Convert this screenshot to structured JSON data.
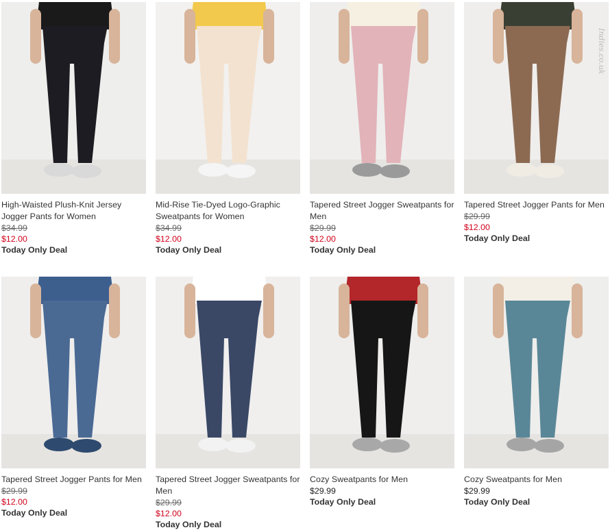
{
  "watermark": "Indies.co.uk",
  "products": [
    {
      "name": "High-Waisted Plush-Knit Jersey Jogger Pants for Women",
      "original_price": "$34.99",
      "sale_price": "$12.00",
      "price": "",
      "deal": "Today Only Deal",
      "pants_color": "#1c1c22",
      "top_color": "#1a1a1a",
      "shoe_color": "#d9d9d9",
      "bg": "#eeeeec"
    },
    {
      "name": "Mid-Rise Tie-Dyed Logo-Graphic Sweatpants for Women",
      "original_price": "$34.99",
      "sale_price": "$12.00",
      "price": "",
      "deal": "Today Only Deal",
      "pants_color": "#f3e2d0",
      "top_color": "#f2c94c",
      "shoe_color": "#f5f5f5",
      "bg": "#f2f1ef"
    },
    {
      "name": "Tapered Street Jogger Sweatpants for Men",
      "original_price": "$29.99",
      "sale_price": "$12.00",
      "price": "",
      "deal": "Today Only Deal",
      "pants_color": "#e2b3b9",
      "top_color": "#f6f0e2",
      "shoe_color": "#9a9a9a",
      "bg": "#efeeed"
    },
    {
      "name": "Tapered Street Jogger Pants for Men",
      "original_price": "$29.99",
      "sale_price": "$12.00",
      "price": "",
      "deal": "Today Only Deal",
      "pants_color": "#8c6a52",
      "top_color": "#3a3f33",
      "shoe_color": "#f0ece4",
      "bg": "#efeeec"
    },
    {
      "name": "Tapered Street Jogger Pants for Men",
      "original_price": "$29.99",
      "sale_price": "$12.00",
      "price": "",
      "deal": "Today Only Deal",
      "pants_color": "#4a6a94",
      "top_color": "#3d5f8e",
      "shoe_color": "#2e4a6e",
      "bg": "#efeeed"
    },
    {
      "name": "Tapered Street Jogger Sweatpants for Men",
      "original_price": "$29.99",
      "sale_price": "$12.00",
      "price": "",
      "deal": "Today Only Deal",
      "pants_color": "#3a4866",
      "top_color": "#ffffff",
      "shoe_color": "#f2f2f2",
      "bg": "#f0efee"
    },
    {
      "name": "Cozy Sweatpants for Men",
      "original_price": "",
      "sale_price": "",
      "price": "$29.99",
      "deal": "Today Only Deal",
      "pants_color": "#161616",
      "top_color": "#b3262a",
      "shoe_color": "#a8a8a8",
      "bg": "#efeeed"
    },
    {
      "name": "Cozy Sweatpants for Men",
      "original_price": "",
      "sale_price": "",
      "price": "$29.99",
      "deal": "Today Only Deal",
      "pants_color": "#5a8798",
      "top_color": "#f3efe6",
      "shoe_color": "#a5a5a5",
      "bg": "#eeeeec"
    }
  ]
}
